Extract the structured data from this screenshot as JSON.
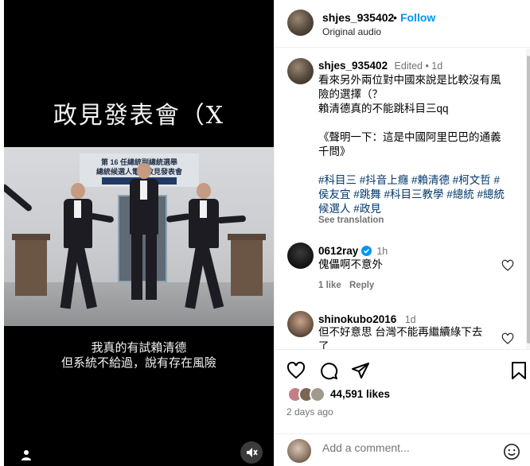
{
  "video": {
    "title": "政見發表會（X",
    "banner_line1": "第 16 任總統副總統選舉",
    "banner_line2": "總統候選人電視政見發表會",
    "caption_line1": "我真的有試賴清德",
    "caption_line2": "但系統不給過，說有存在風險",
    "mute_icon": "muted-speaker-icon",
    "user_tag_icon": "person-icon"
  },
  "header": {
    "username": "shjes_935402",
    "dot": "•",
    "follow_label": "Follow",
    "audio": "Original audio"
  },
  "caption_post": {
    "username": "shjes_935402",
    "meta": "Edited • 1d",
    "line1": "看來另外兩位對中國來說是比較沒有風",
    "line2": "險的選擇（？",
    "line3": "賴清德真的不能跳科目三qq",
    "line4": "《聲明一下：這是中國阿里巴巴的通義",
    "line5": "千問》",
    "hashtags1": "#科目三 #抖音上癮 #賴清德 #柯文哲 #",
    "hashtags2": "侯友宜 #跳舞 #科目三教學 #總統 #總統",
    "hashtags3": "候選人 #政見",
    "see_translation": "See translation"
  },
  "comments": [
    {
      "username": "0612ray",
      "verified": true,
      "time": "1h",
      "text": "傀儡啊不意外",
      "likes": "1 like",
      "reply": "Reply"
    },
    {
      "username": "shinokubo2016",
      "time": "1d",
      "text_line1": "但不好意思 台灣不能再繼續綠下去",
      "text_line2": "了"
    }
  ],
  "actions": {
    "likes": "44,591 likes",
    "date": "2 days ago",
    "add_comment_placeholder": "Add a comment...",
    "emoji_icon": "smiley-icon"
  },
  "colors": {
    "accent": "#0095f6",
    "link": "#00376b",
    "muted": "#737373",
    "verified": "#0095f6"
  }
}
